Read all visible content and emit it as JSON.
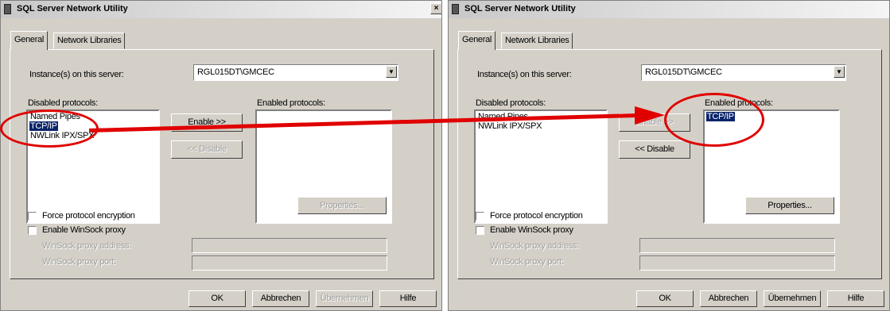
{
  "dialogs": [
    {
      "title": "SQL Server Network Utility",
      "close_glyph": "×",
      "tabs": [
        "General",
        "Network Libraries"
      ],
      "instance_label": "Instance(s) on this server:",
      "instance_value": "RGL015DT\\GMCEC",
      "combo_arrow_glyph": "▼",
      "disabled_label": "Disabled protocols:",
      "enabled_label": "Enabled protocols:",
      "disabled_items": [
        "Named Pipes",
        "TCP/IP",
        "NWLink IPX/SPX"
      ],
      "disabled_selected": "TCP/IP",
      "enabled_items": [],
      "enable_btn": "Enable >>",
      "disable_btn": "<< Disable",
      "properties_btn": "Properties...",
      "force_encryption": "Force protocol encryption",
      "enable_winsock": "Enable WinSock proxy",
      "winsock_address": "WinSock proxy address:",
      "winsock_port": "WinSock proxy port:",
      "ok_btn": "OK",
      "cancel_btn": "Abbrechen",
      "apply_btn": "Übernehmen",
      "help_btn": "Hilfe"
    },
    {
      "title": "SQL Server Network Utility",
      "close_glyph": "×",
      "tabs": [
        "General",
        "Network Libraries"
      ],
      "instance_label": "Instance(s) on this server:",
      "instance_value": "RGL015DT\\GMCEC",
      "combo_arrow_glyph": "▼",
      "disabled_label": "Disabled protocols:",
      "enabled_label": "Enabled protocols:",
      "disabled_items": [
        "Named Pipes",
        "NWLink IPX/SPX"
      ],
      "enabled_items": [
        "TCP/IP"
      ],
      "enabled_selected": "TCP/IP",
      "enable_btn": "Enable >>",
      "disable_btn": "<< Disable",
      "properties_btn": "Properties...",
      "force_encryption": "Force protocol encryption",
      "enable_winsock": "Enable WinSock proxy",
      "winsock_address": "WinSock proxy address:",
      "winsock_port": "WinSock proxy port:",
      "ok_btn": "OK",
      "cancel_btn": "Abbrechen",
      "apply_btn": "Übernehmen",
      "help_btn": "Hilfe"
    }
  ],
  "annotation": {
    "color": "#e00000",
    "from": "TCP/IP (Disabled protocols)",
    "to": "TCP/IP (Enabled protocols)"
  }
}
